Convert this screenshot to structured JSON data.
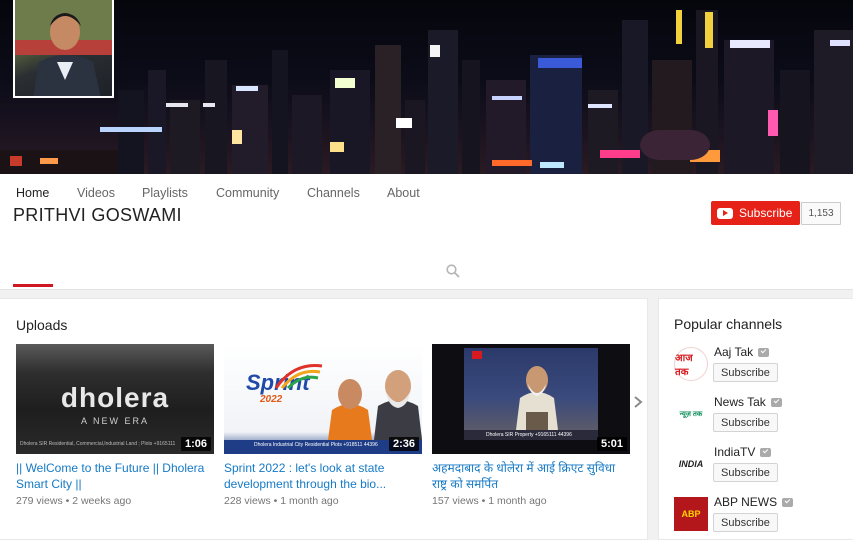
{
  "channel": {
    "name": "PRITHVI GOSWAMI",
    "subscribe_label": "Subscribe",
    "subscriber_count": "1,153"
  },
  "tabs": [
    {
      "label": "Home",
      "active": true
    },
    {
      "label": "Videos"
    },
    {
      "label": "Playlists"
    },
    {
      "label": "Community"
    },
    {
      "label": "Channels"
    },
    {
      "label": "About"
    }
  ],
  "uploads": {
    "title": "Uploads",
    "videos": [
      {
        "title": "|| WelCome to the Future || Dholera Smart City ||",
        "views": "279 views",
        "age": "2 weeks ago",
        "duration": "1:06",
        "thumb_text": "dholera",
        "thumb_sub": "A NEW ERA",
        "thumb_caption": "Dholera SIR Residential, Commercial,Industrial Land ; Plots +9165111"
      },
      {
        "title": "Sprint 2022 : let's look at state development through the bio...",
        "views": "228 views",
        "age": "1 month ago",
        "duration": "2:36",
        "thumb_text": "Sprint",
        "thumb_sub": "2022",
        "thumb_caption": "Dholera Industrial City Residential Plots +918511 44396"
      },
      {
        "title": "अहमदाबाद के धोलेरा में आई क्रिएट सुविधा राष्ट्र को समर्पित",
        "views": "157 views",
        "age": "1 month ago",
        "duration": "5:01",
        "thumb_caption": "Dholera SIR Property +9165111 44396"
      }
    ]
  },
  "popular": {
    "title": "Popular channels",
    "subscribe_label": "Subscribe",
    "channels": [
      {
        "name": "Aaj Tak",
        "logo_text": "आज तक",
        "logo_bg": "#ffffff",
        "logo_fg": "#d71920"
      },
      {
        "name": "News Tak",
        "logo_text": "न्यूज़ तक",
        "logo_bg": "#ffffff",
        "logo_fg": "#0a8f5a"
      },
      {
        "name": "IndiaTV",
        "logo_text": "INDIA",
        "logo_bg": "#ffffff",
        "logo_fg": "#222222"
      },
      {
        "name": "ABP NEWS",
        "logo_text": "ABP",
        "logo_bg": "#b3161b",
        "logo_fg": "#ffd400"
      }
    ]
  },
  "colors": {
    "accent_red": "#e62117",
    "link_blue": "#167ac6"
  },
  "icons": {
    "subscribe": "youtube-play-icon",
    "search": "search-icon",
    "next": "chevron-right-icon",
    "verified": "verified-check-icon"
  }
}
